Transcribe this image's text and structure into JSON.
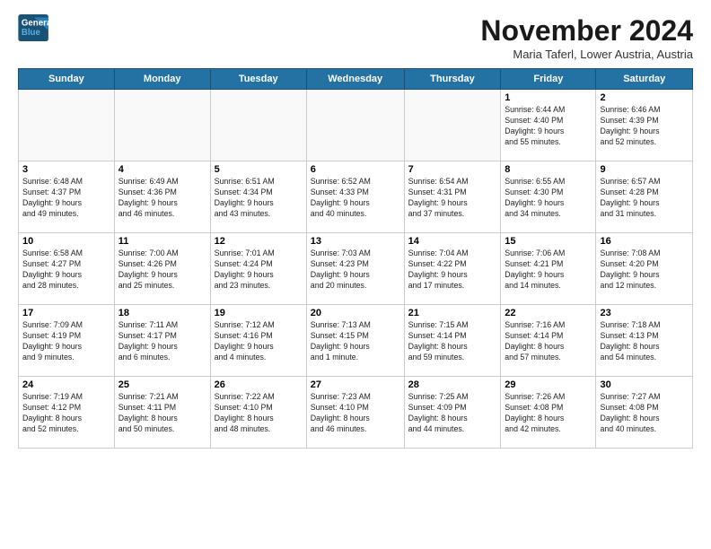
{
  "header": {
    "logo_line1": "General",
    "logo_line2": "Blue",
    "month_title": "November 2024",
    "subtitle": "Maria Taferl, Lower Austria, Austria"
  },
  "days_of_week": [
    "Sunday",
    "Monday",
    "Tuesday",
    "Wednesday",
    "Thursday",
    "Friday",
    "Saturday"
  ],
  "weeks": [
    [
      {
        "day": "",
        "info": ""
      },
      {
        "day": "",
        "info": ""
      },
      {
        "day": "",
        "info": ""
      },
      {
        "day": "",
        "info": ""
      },
      {
        "day": "",
        "info": ""
      },
      {
        "day": "1",
        "info": "Sunrise: 6:44 AM\nSunset: 4:40 PM\nDaylight: 9 hours\nand 55 minutes."
      },
      {
        "day": "2",
        "info": "Sunrise: 6:46 AM\nSunset: 4:39 PM\nDaylight: 9 hours\nand 52 minutes."
      }
    ],
    [
      {
        "day": "3",
        "info": "Sunrise: 6:48 AM\nSunset: 4:37 PM\nDaylight: 9 hours\nand 49 minutes."
      },
      {
        "day": "4",
        "info": "Sunrise: 6:49 AM\nSunset: 4:36 PM\nDaylight: 9 hours\nand 46 minutes."
      },
      {
        "day": "5",
        "info": "Sunrise: 6:51 AM\nSunset: 4:34 PM\nDaylight: 9 hours\nand 43 minutes."
      },
      {
        "day": "6",
        "info": "Sunrise: 6:52 AM\nSunset: 4:33 PM\nDaylight: 9 hours\nand 40 minutes."
      },
      {
        "day": "7",
        "info": "Sunrise: 6:54 AM\nSunset: 4:31 PM\nDaylight: 9 hours\nand 37 minutes."
      },
      {
        "day": "8",
        "info": "Sunrise: 6:55 AM\nSunset: 4:30 PM\nDaylight: 9 hours\nand 34 minutes."
      },
      {
        "day": "9",
        "info": "Sunrise: 6:57 AM\nSunset: 4:28 PM\nDaylight: 9 hours\nand 31 minutes."
      }
    ],
    [
      {
        "day": "10",
        "info": "Sunrise: 6:58 AM\nSunset: 4:27 PM\nDaylight: 9 hours\nand 28 minutes."
      },
      {
        "day": "11",
        "info": "Sunrise: 7:00 AM\nSunset: 4:26 PM\nDaylight: 9 hours\nand 25 minutes."
      },
      {
        "day": "12",
        "info": "Sunrise: 7:01 AM\nSunset: 4:24 PM\nDaylight: 9 hours\nand 23 minutes."
      },
      {
        "day": "13",
        "info": "Sunrise: 7:03 AM\nSunset: 4:23 PM\nDaylight: 9 hours\nand 20 minutes."
      },
      {
        "day": "14",
        "info": "Sunrise: 7:04 AM\nSunset: 4:22 PM\nDaylight: 9 hours\nand 17 minutes."
      },
      {
        "day": "15",
        "info": "Sunrise: 7:06 AM\nSunset: 4:21 PM\nDaylight: 9 hours\nand 14 minutes."
      },
      {
        "day": "16",
        "info": "Sunrise: 7:08 AM\nSunset: 4:20 PM\nDaylight: 9 hours\nand 12 minutes."
      }
    ],
    [
      {
        "day": "17",
        "info": "Sunrise: 7:09 AM\nSunset: 4:19 PM\nDaylight: 9 hours\nand 9 minutes."
      },
      {
        "day": "18",
        "info": "Sunrise: 7:11 AM\nSunset: 4:17 PM\nDaylight: 9 hours\nand 6 minutes."
      },
      {
        "day": "19",
        "info": "Sunrise: 7:12 AM\nSunset: 4:16 PM\nDaylight: 9 hours\nand 4 minutes."
      },
      {
        "day": "20",
        "info": "Sunrise: 7:13 AM\nSunset: 4:15 PM\nDaylight: 9 hours\nand 1 minute."
      },
      {
        "day": "21",
        "info": "Sunrise: 7:15 AM\nSunset: 4:14 PM\nDaylight: 8 hours\nand 59 minutes."
      },
      {
        "day": "22",
        "info": "Sunrise: 7:16 AM\nSunset: 4:14 PM\nDaylight: 8 hours\nand 57 minutes."
      },
      {
        "day": "23",
        "info": "Sunrise: 7:18 AM\nSunset: 4:13 PM\nDaylight: 8 hours\nand 54 minutes."
      }
    ],
    [
      {
        "day": "24",
        "info": "Sunrise: 7:19 AM\nSunset: 4:12 PM\nDaylight: 8 hours\nand 52 minutes."
      },
      {
        "day": "25",
        "info": "Sunrise: 7:21 AM\nSunset: 4:11 PM\nDaylight: 8 hours\nand 50 minutes."
      },
      {
        "day": "26",
        "info": "Sunrise: 7:22 AM\nSunset: 4:10 PM\nDaylight: 8 hours\nand 48 minutes."
      },
      {
        "day": "27",
        "info": "Sunrise: 7:23 AM\nSunset: 4:10 PM\nDaylight: 8 hours\nand 46 minutes."
      },
      {
        "day": "28",
        "info": "Sunrise: 7:25 AM\nSunset: 4:09 PM\nDaylight: 8 hours\nand 44 minutes."
      },
      {
        "day": "29",
        "info": "Sunrise: 7:26 AM\nSunset: 4:08 PM\nDaylight: 8 hours\nand 42 minutes."
      },
      {
        "day": "30",
        "info": "Sunrise: 7:27 AM\nSunset: 4:08 PM\nDaylight: 8 hours\nand 40 minutes."
      }
    ]
  ]
}
